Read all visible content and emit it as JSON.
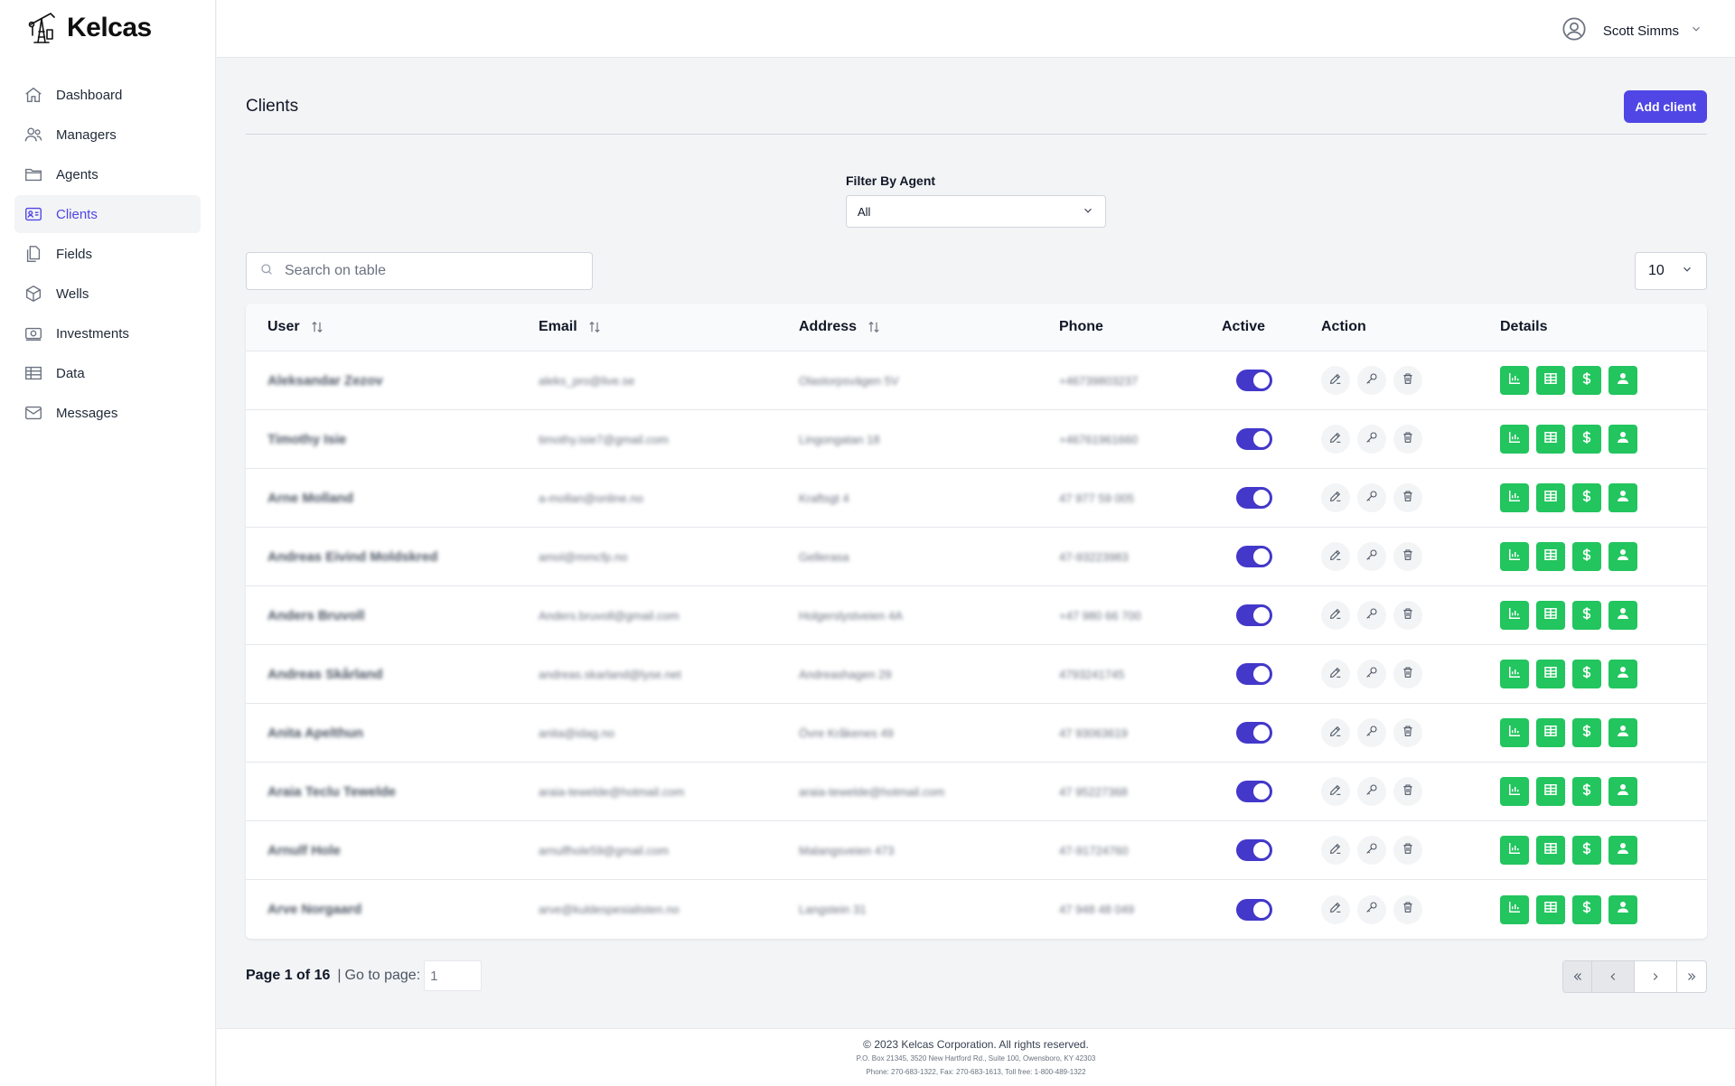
{
  "app": {
    "name": "Kelcas"
  },
  "sidebar": {
    "items": [
      {
        "label": "Dashboard",
        "icon": "home-icon"
      },
      {
        "label": "Managers",
        "icon": "users-icon"
      },
      {
        "label": "Agents",
        "icon": "folder-icon"
      },
      {
        "label": "Clients",
        "icon": "id-card-icon",
        "active": true
      },
      {
        "label": "Fields",
        "icon": "documents-icon"
      },
      {
        "label": "Wells",
        "icon": "cube-icon"
      },
      {
        "label": "Investments",
        "icon": "money-icon"
      },
      {
        "label": "Data",
        "icon": "table-icon"
      },
      {
        "label": "Messages",
        "icon": "mail-icon"
      }
    ]
  },
  "header": {
    "user_name": "Scott Simms"
  },
  "page": {
    "title": "Clients",
    "add_button": "Add client"
  },
  "filter": {
    "label": "Filter By Agent",
    "selected": "All"
  },
  "search": {
    "placeholder": "Search on table",
    "value": ""
  },
  "page_size": "10",
  "table": {
    "columns": [
      "User",
      "Email",
      "Address",
      "Phone",
      "Active",
      "Action",
      "Details"
    ],
    "rows": [
      {
        "user": "Aleksandar Zezov",
        "email": "aleks_pro@live.se",
        "address": "Olastorpsvägen 5V",
        "phone": "+46739803237",
        "active": true
      },
      {
        "user": "Timothy Isie",
        "email": "timothy.isie7@gmail.com",
        "address": "Lingongatan 18",
        "phone": "+46761961660",
        "active": true
      },
      {
        "user": "Arne Molland",
        "email": "a-mollan@online.no",
        "address": "Kraftsgt 4",
        "phone": "47 977 59 005",
        "active": true
      },
      {
        "user": "Andreas Eivind Moldskred",
        "email": "amol@mmcfp.no",
        "address": "Gellerasa",
        "phone": "47-93223983",
        "active": true
      },
      {
        "user": "Anders Bruvoll",
        "email": "Anders.bruvoll@gmail.com",
        "address": "Holgerslystveien 4A",
        "phone": "+47 980 66 700",
        "active": true
      },
      {
        "user": "Andreas Skårland",
        "email": "andreas.skarland@lyse.net",
        "address": "Andreashagen 29",
        "phone": "4793241745",
        "active": true
      },
      {
        "user": "Anita Apelthun",
        "email": "anita@idag.no",
        "address": "Övre Kråkenes 49",
        "phone": "47 93063619",
        "active": true
      },
      {
        "user": "Araia Teclu Tewelde",
        "email": "araia-tewelde@hotmail.com",
        "address": "araia-tewelde@hotmail.com",
        "phone": "47 95227368",
        "active": true
      },
      {
        "user": "Arnulf Hole",
        "email": "arnulfhole59@gmail.com",
        "address": "Malangsveien 473",
        "phone": "47-91724760",
        "active": true
      },
      {
        "user": "Arve Norgaard",
        "email": "arve@kuldespesialisten.no",
        "address": "Langstein 31",
        "phone": "47 948 48 049",
        "active": true
      }
    ]
  },
  "pagination": {
    "page_text": "Page 1 of 16",
    "separator": "|",
    "goto_label": "Go to page:",
    "goto_value": "1"
  },
  "footer": {
    "copyright": "© 2023 Kelcas Corporation. All rights reserved.",
    "address": "P.O. Box 21345, 3520 New Hartford Rd., Suite 100, Owensboro, KY 42303",
    "phone": "Phone: 270-683-1322, Fax: 270-683-1613, Toll free: 1-800-489-1322"
  },
  "colors": {
    "accent": "#4f46e5",
    "success": "#22c55e",
    "toggle": "#4338ca"
  }
}
